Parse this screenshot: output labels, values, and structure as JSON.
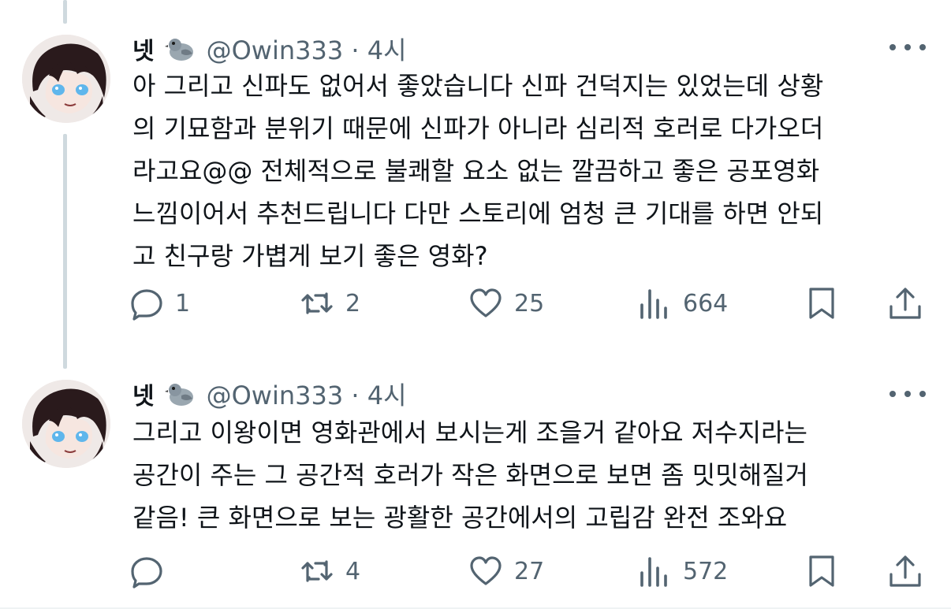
{
  "tweets": [
    {
      "name": "넷",
      "handle": "@Owin333 · 4시",
      "text": "아 그리고 신파도 없어서 좋았습니다 신파 건덕지는 있었는데 상황\n의 기묘함과 분위기 때문에 신파가 아니라 심리적 호러로 다가오더\n라고요@@ 전체적으로 불쾌할 요소 없는 깔끔하고 좋은 공포영화\n느낌이어서 추천드립니다 다만 스토리에 엄청 큰 기대를 하면 안되\n고 친구랑 가볍게 보기 좋은 영화?",
      "replies": "1",
      "reposts": "2",
      "likes": "25",
      "views": "664"
    },
    {
      "name": "넷",
      "handle": "@Owin333 · 4시",
      "text": "그리고 이왕이면 영화관에서 보시는게 조을거 같아요 저수지라는\n공간이 주는 그 공간적 호러가 작은 화면으로 보면 좀 밋밋해질거\n같음! 큰 화면으로 보는 광활한 공간에서의 고립감 완전 조와요",
      "replies": "",
      "reposts": "4",
      "likes": "27",
      "views": "572"
    }
  ],
  "icons": {
    "badge": "pigeon-icon",
    "more": "more-dots-icon",
    "reply": "reply-icon",
    "repost": "repost-icon",
    "like": "heart-icon",
    "views": "views-icon",
    "bookmark": "bookmark-icon",
    "share": "share-icon"
  },
  "colors": {
    "text": "#0f1419",
    "secondary": "#536471",
    "thread_line": "#cfd9de"
  }
}
